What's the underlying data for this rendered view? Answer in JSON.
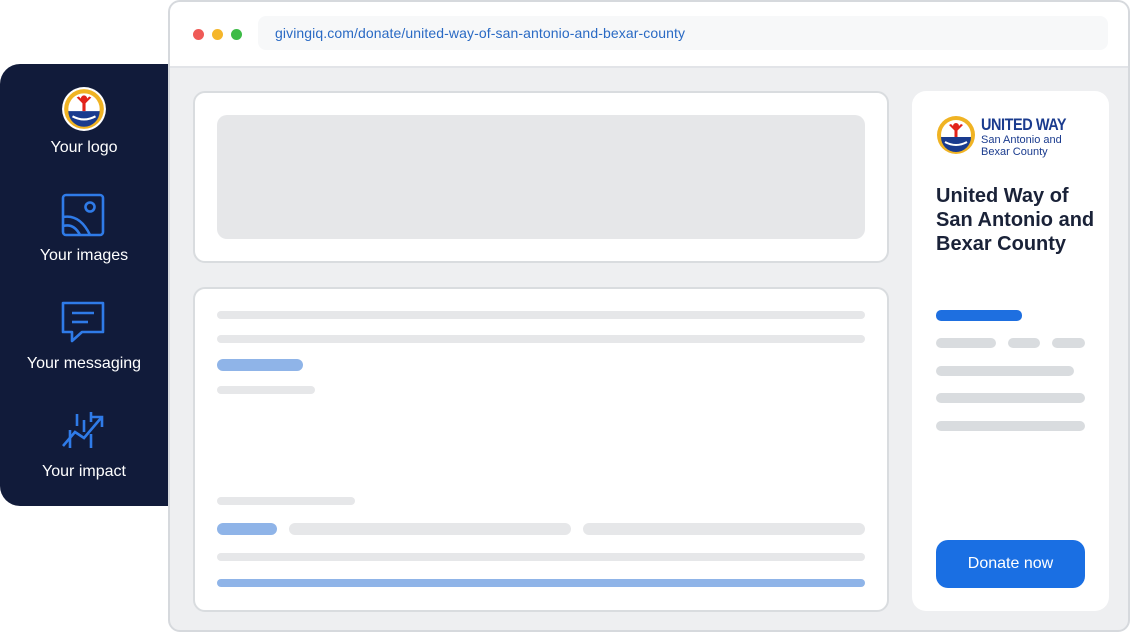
{
  "browser": {
    "url": "givingiq.com/donate/united-way-of-san-antonio-and-bexar-county"
  },
  "features": [
    {
      "label": "Your logo",
      "icon": "united-way-logo-icon"
    },
    {
      "label": "Your images",
      "icon": "image-icon"
    },
    {
      "label": "Your messaging",
      "icon": "chat-message-icon"
    },
    {
      "label": "Your impact",
      "icon": "growth-chart-icon"
    }
  ],
  "organization": {
    "logo_title": "UNITED WAY",
    "logo_subtitle": "San Antonio and Bexar County",
    "name": "United Way of San Antonio and Bexar County",
    "donate_label": "Donate now"
  },
  "colors": {
    "panel": "#111b3a",
    "accent": "#1a6fe3",
    "placeholder": "#e6e7e9",
    "placeholder_blue": "#8fb4e8"
  }
}
